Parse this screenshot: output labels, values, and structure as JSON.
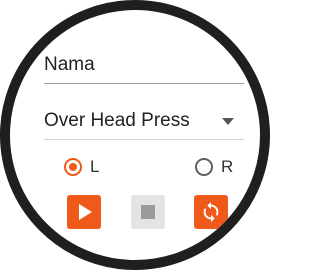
{
  "form": {
    "name_value": "Nama",
    "exercise_value": "Over Head Press"
  },
  "side": {
    "left_label": "L",
    "right_label": "R",
    "selected": "L"
  },
  "controls": {
    "play_icon": "play-icon",
    "stop_icon": "stop-icon",
    "cycle_icon": "sync-icon"
  },
  "colors": {
    "accent": "#ef5a1a",
    "disabled": "#e4e4e4",
    "bezel": "#1f1f1f"
  }
}
